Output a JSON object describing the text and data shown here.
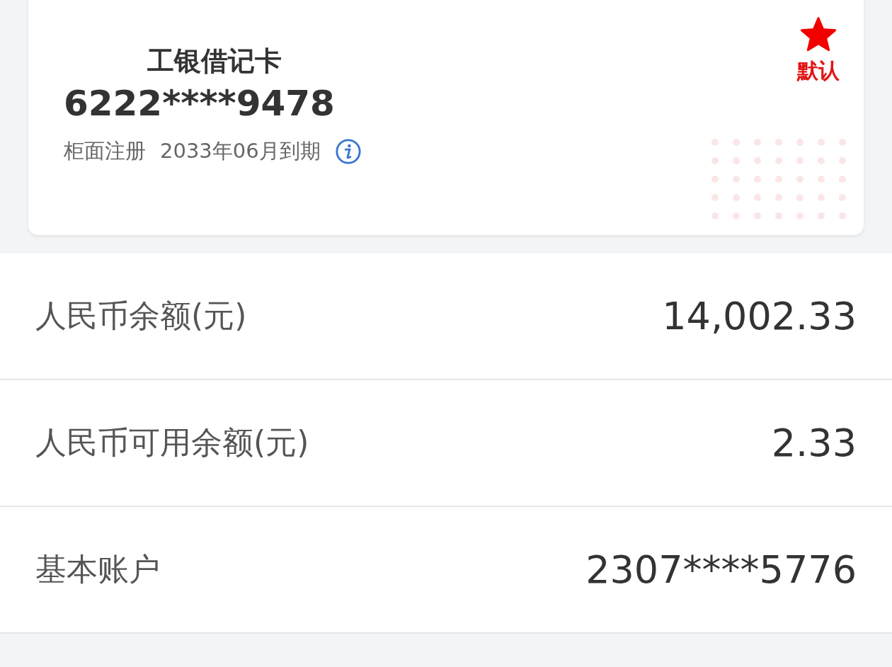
{
  "card": {
    "name": "工银借记卡",
    "number": "6222****9478",
    "registration": "柜面注册",
    "expiry": "2033年06月到期",
    "is_default": true,
    "default_label": "默认"
  },
  "rows": [
    {
      "label": "人民币余额(元)",
      "value": "14,002.33"
    },
    {
      "label": "人民币可用余额(元)",
      "value": "2.33"
    },
    {
      "label": "基本账户",
      "value": "2307****5776"
    }
  ]
}
